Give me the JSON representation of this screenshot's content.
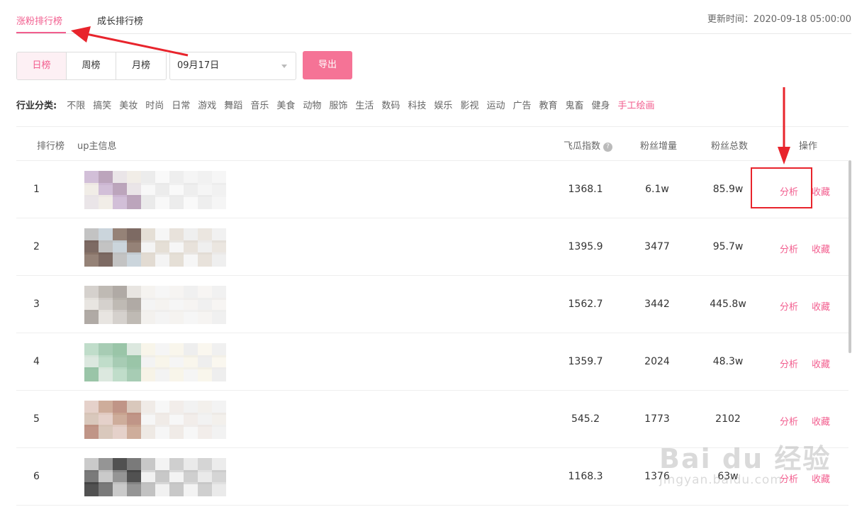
{
  "top_tabs": [
    "涨粉排行榜",
    "成长排行榜"
  ],
  "update_time": "更新时间：2020-09-18 05:00:00",
  "periods": [
    "日榜",
    "周榜",
    "月榜"
  ],
  "date_value": "09月17日",
  "export_label": "导出",
  "industry": {
    "label": "行业分类:",
    "items": [
      "不限",
      "搞笑",
      "美妆",
      "时尚",
      "日常",
      "游戏",
      "舞蹈",
      "音乐",
      "美食",
      "动物",
      "服饰",
      "生活",
      "数码",
      "科技",
      "娱乐",
      "影视",
      "运动",
      "广告",
      "教育",
      "鬼畜",
      "健身",
      "手工绘画"
    ]
  },
  "columns": {
    "rank": "排行榜",
    "info": "up主信息",
    "index": "飞瓜指数",
    "growth": "粉丝增量",
    "total": "粉丝总数",
    "ops": "操作"
  },
  "help_icon": "question-icon",
  "rows": [
    {
      "rank": "1",
      "index": "1368.1",
      "growth": "6.1w",
      "total": "85.9w",
      "analyze": "分析",
      "favorite": "收藏"
    },
    {
      "rank": "2",
      "index": "1395.9",
      "growth": "3477",
      "total": "95.7w",
      "analyze": "分析",
      "favorite": "收藏"
    },
    {
      "rank": "3",
      "index": "1562.7",
      "growth": "3442",
      "total": "445.8w",
      "analyze": "分析",
      "favorite": "收藏"
    },
    {
      "rank": "4",
      "index": "1359.7",
      "growth": "2024",
      "total": "48.3w",
      "analyze": "分析",
      "favorite": "收藏"
    },
    {
      "rank": "5",
      "index": "545.2",
      "growth": "1773",
      "total": "2102",
      "analyze": "分析",
      "favorite": "收藏"
    },
    {
      "rank": "6",
      "index": "1168.3",
      "growth": "1376",
      "total": "63w",
      "analyze": "分析",
      "favorite": "收藏"
    }
  ],
  "watermark": {
    "logo": "Bai du 经验",
    "url": "jingyan.baidu.com"
  },
  "colors": {
    "accent": "#f25d8e",
    "export": "#f57396",
    "annotation": "#e8242c"
  }
}
